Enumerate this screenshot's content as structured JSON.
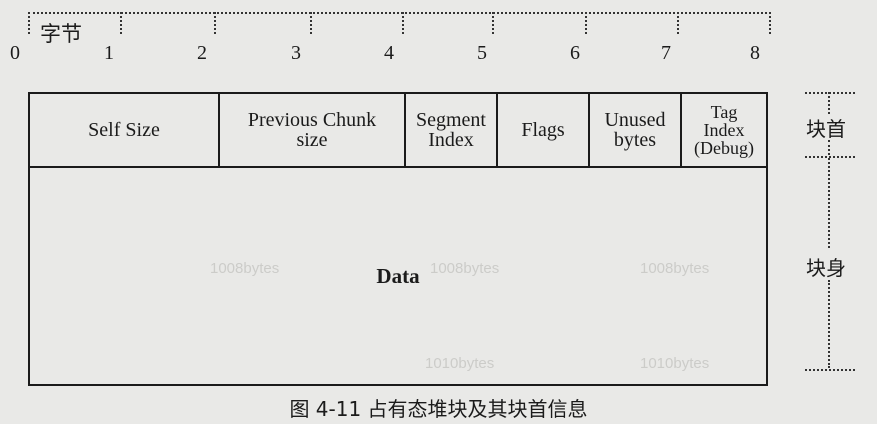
{
  "scale": {
    "unit_label": "字节",
    "ticks": [
      "0",
      "1",
      "2",
      "3",
      "4",
      "5",
      "6",
      "7",
      "8"
    ]
  },
  "header_fields": [
    {
      "id": "self-size",
      "label": "Self  Size",
      "bytes": 2
    },
    {
      "id": "previous-chunk-size",
      "label": "Previous Chunk\nsize",
      "bytes": 2
    },
    {
      "id": "segment-index",
      "label": "Segment\nIndex",
      "bytes": 1
    },
    {
      "id": "flags",
      "label": "Flags",
      "bytes": 1
    },
    {
      "id": "unused-bytes",
      "label": "Unused\nbytes",
      "bytes": 1
    },
    {
      "id": "tag-index",
      "label": "Tag\nIndex\n(Debug)",
      "bytes": 1
    }
  ],
  "body": {
    "label": "Data"
  },
  "side_labels": {
    "header": "块首",
    "body": "块身"
  },
  "caption": "图 4-11    占有态堆块及其块首信息"
}
